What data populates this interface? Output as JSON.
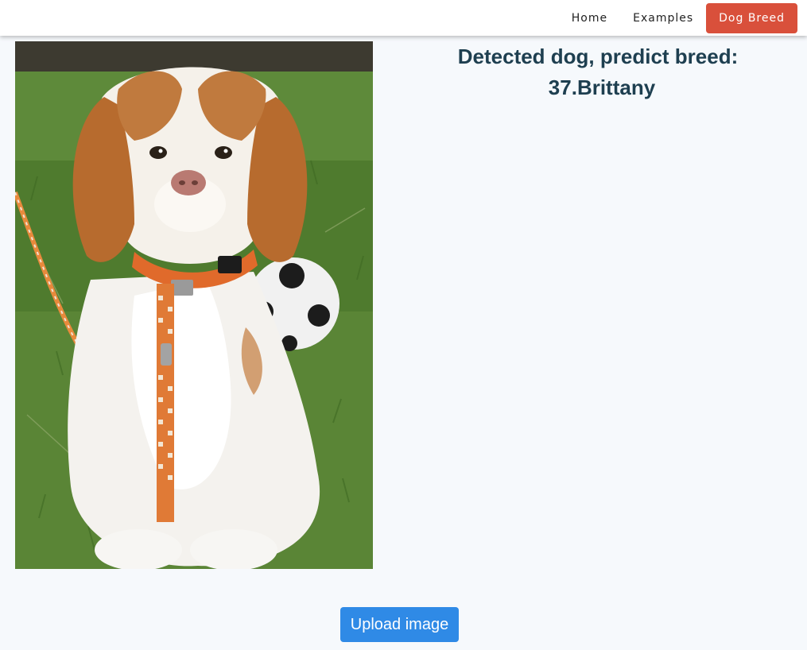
{
  "nav": {
    "items": [
      {
        "label": "Home",
        "active": false
      },
      {
        "label": "Examples",
        "active": false
      },
      {
        "label": "Dog Breed",
        "active": true
      }
    ],
    "active_color": "#d9503b"
  },
  "photo": {
    "subject": "dog-photo-brittany-puppy"
  },
  "result": {
    "line1": "Detected dog, predict breed:",
    "line2": "37.Brittany",
    "color": "#1e3f50"
  },
  "upload": {
    "label": "Upload image",
    "color": "#2f8ae6"
  }
}
